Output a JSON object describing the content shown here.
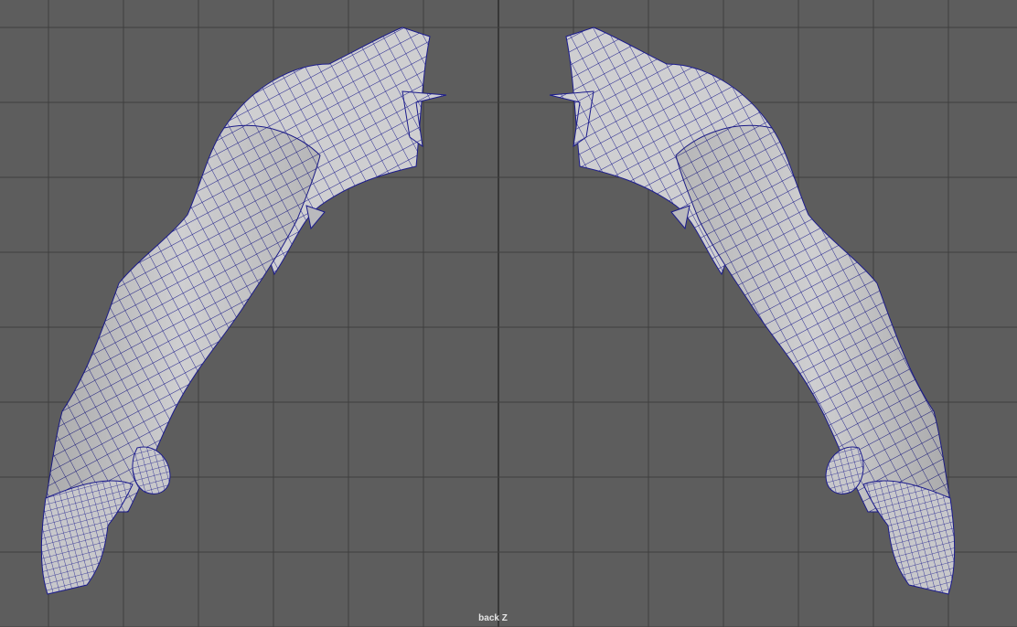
{
  "viewport": {
    "camera_label": "back Z",
    "colors": {
      "background": "#5d5d5d",
      "grid_line": "#3f3f3f",
      "grid_axis": "#2b2b2b",
      "mesh_fill": "#cfcfd1",
      "mesh_shade": "#a9a9ad",
      "wireframe": "#1c1c8c"
    },
    "objects": [
      "left-arm-mesh",
      "right-arm-mesh"
    ]
  }
}
